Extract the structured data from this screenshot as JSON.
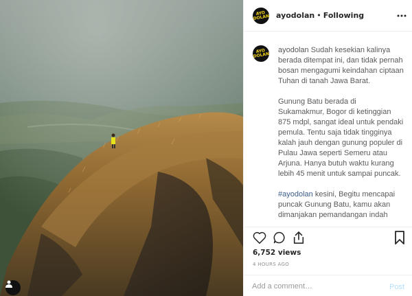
{
  "post": {
    "username": "ayodolan",
    "separator": "•",
    "follow_status": "Following",
    "avatar_logo_text": "AYO DOLAN",
    "caption_paragraphs": [
      "Sudah kesekian kalinya berada ditempat ini, dan tidak pernah bosan mengagumi keindahan ciptaan Tuhan di tanah Jawa Barat.",
      "Gunung Batu berada di Sukamakmur, Bogor di ketinggian 875 mdpl, sangat ideal untuk pendaki pemula. Tentu saja tidak tingginya kalah jauh dengan gunung populer di Pulau Jawa seperti Semeru atau Arjuna. Hanya butuh waktu kurang lebih 45 menit untuk sampai puncak."
    ],
    "caption_hashtag": "#ayodolan",
    "caption_after_hashtag": " kesini, Begitu mencapai puncak Gunung Batu, kamu akan dimanjakan pemandangan indah",
    "views": "6,752 views",
    "timestamp": "4 HOURS AGO",
    "comment_placeholder": "Add a comment…",
    "post_label": "Post"
  },
  "icons": {
    "more": "more-horizontal-icon",
    "like": "heart-icon",
    "comment": "comment-bubble-icon",
    "share": "share-icon",
    "save": "bookmark-icon",
    "user_tag": "user-tag-icon"
  },
  "colors": {
    "hashtag": "#3b5d8a",
    "post_button": "#b2dffc",
    "avatar_logo": "#f3d41b"
  }
}
